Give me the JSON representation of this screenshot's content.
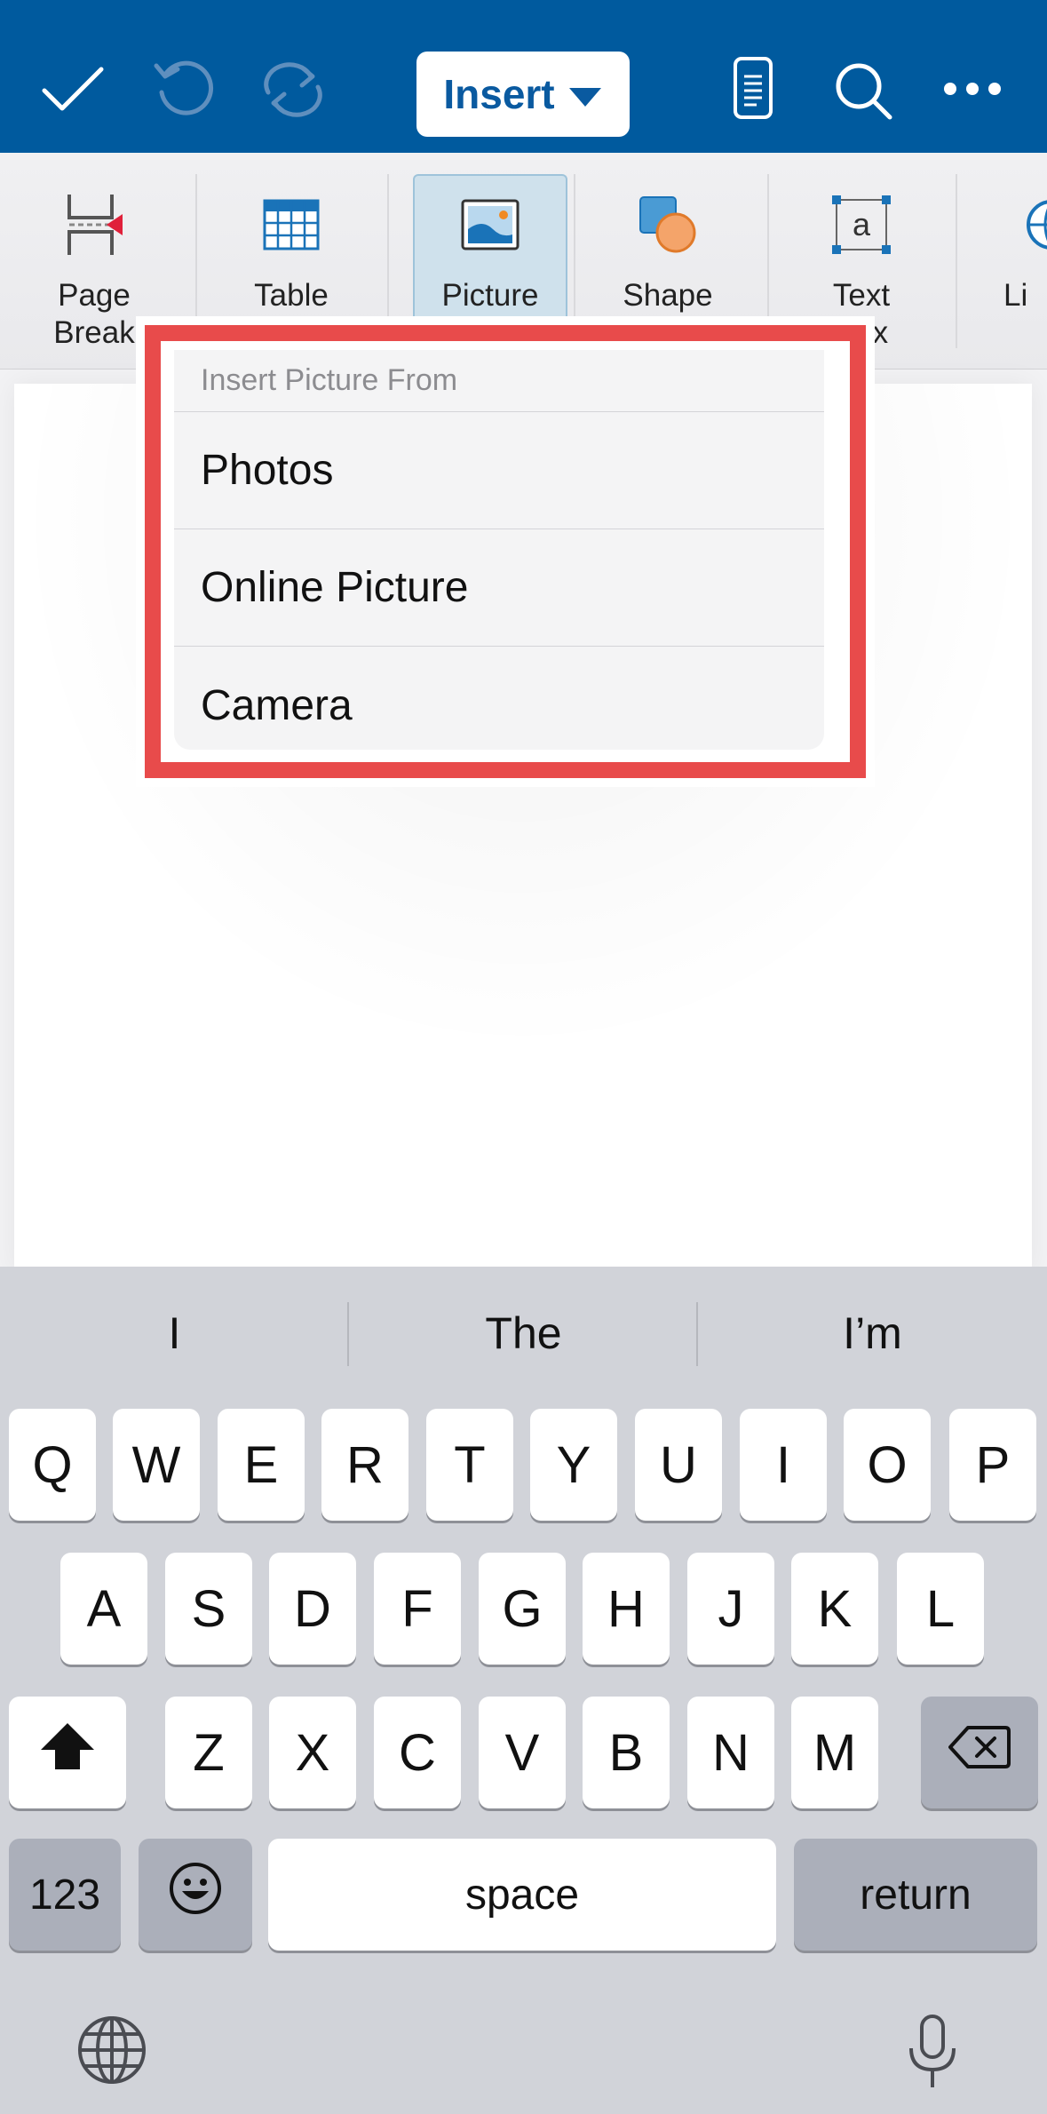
{
  "toolbar": {
    "insert_label": "Insert"
  },
  "ribbon": {
    "items": [
      {
        "label": "Page\nBreak",
        "icon": "page-break-icon"
      },
      {
        "label": "Table",
        "icon": "table-icon"
      },
      {
        "label": "Picture",
        "icon": "picture-icon",
        "selected": true
      },
      {
        "label": "Shape",
        "icon": "shape-icon"
      },
      {
        "label": "Text\nBox",
        "icon": "text-box-icon"
      },
      {
        "label": "Li",
        "icon": "link-icon"
      }
    ]
  },
  "popup": {
    "header": "Insert Picture From",
    "items": [
      "Photos",
      "Online Picture",
      "Camera"
    ]
  },
  "keyboard": {
    "suggestions": [
      "I",
      "The",
      "I’m"
    ],
    "row1": [
      "Q",
      "W",
      "E",
      "R",
      "T",
      "Y",
      "U",
      "I",
      "O",
      "P"
    ],
    "row2": [
      "A",
      "S",
      "D",
      "F",
      "G",
      "H",
      "J",
      "K",
      "L"
    ],
    "row3": [
      "Z",
      "X",
      "C",
      "V",
      "B",
      "N",
      "M"
    ],
    "numbers_label": "123",
    "space_label": "space",
    "return_label": "return"
  },
  "colors": {
    "brand_blue": "#005a9e",
    "highlight_red": "#e84b4b",
    "selected_ribbon": "#cfe1ec"
  }
}
